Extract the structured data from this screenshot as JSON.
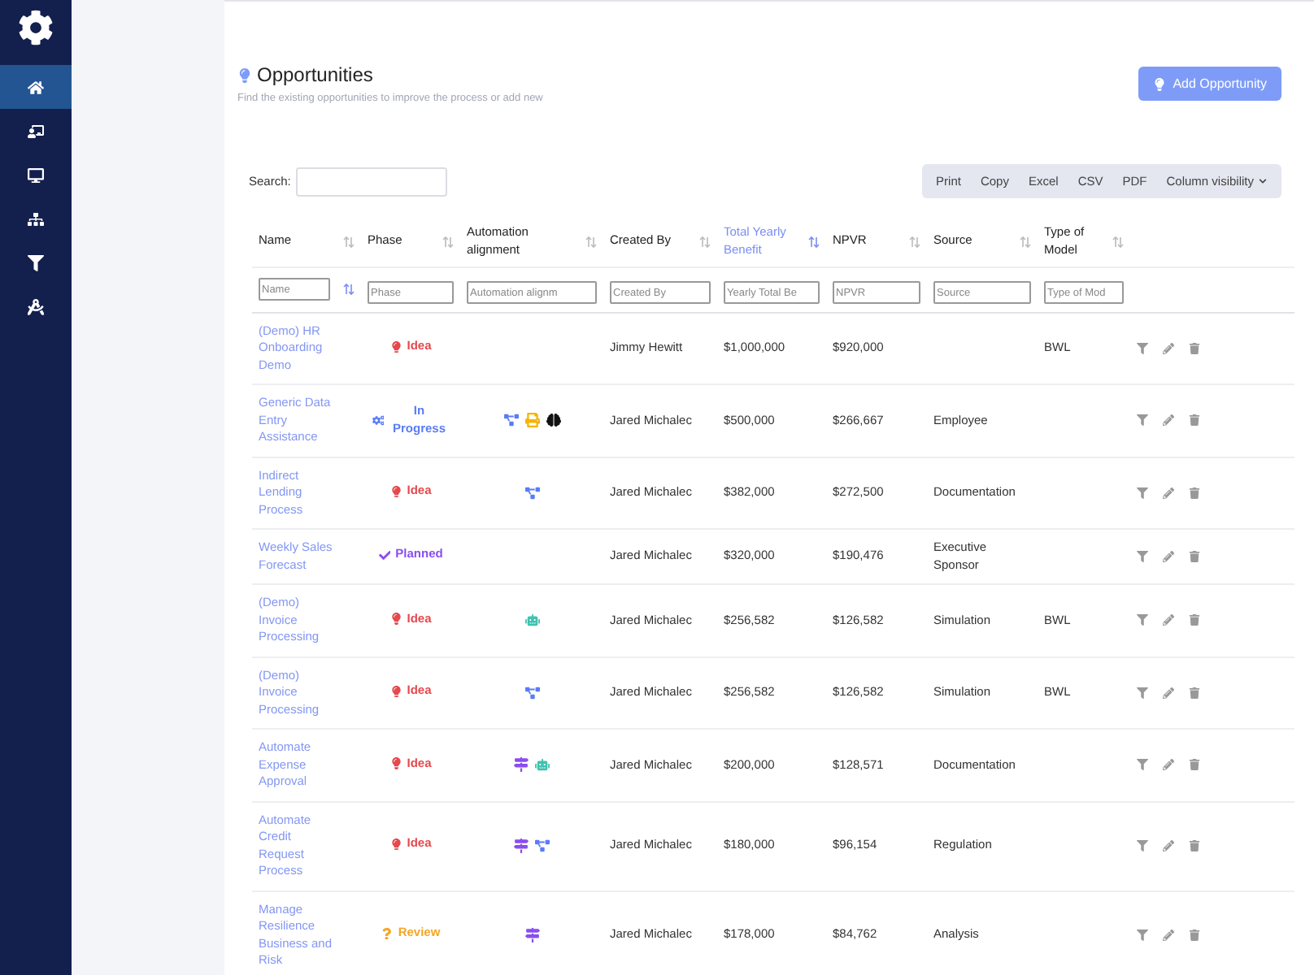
{
  "sidebar": {
    "items": [
      {
        "kind": "home",
        "selected": true
      },
      {
        "kind": "presenter",
        "selected": false
      },
      {
        "kind": "desktop",
        "selected": false
      },
      {
        "kind": "sitemap",
        "selected": false
      },
      {
        "kind": "filter",
        "selected": false
      },
      {
        "kind": "compass",
        "selected": false
      }
    ]
  },
  "header": {
    "title": "Opportunities",
    "subtitle": "Find the existing opportunities to improve the process or add new",
    "add_button": "Add Opportunity"
  },
  "search": {
    "label": "Search:"
  },
  "export_buttons": [
    "Print",
    "Copy",
    "Excel",
    "CSV",
    "PDF"
  ],
  "column_visibility": "Column visibility",
  "table": {
    "columns": [
      {
        "label": "Name",
        "filter_placeholder": "Name",
        "selected": false
      },
      {
        "label": "Phase",
        "filter_placeholder": "Phase",
        "selected": false
      },
      {
        "label": "Automation alignment",
        "filter_placeholder": "Automation alignm",
        "selected": false
      },
      {
        "label": "Created By",
        "filter_placeholder": "Created By",
        "selected": false
      },
      {
        "label": "Total Yearly Benefit",
        "filter_placeholder": "Yearly Total Be",
        "selected": true
      },
      {
        "label": "NPVR",
        "filter_placeholder": "NPVR",
        "selected": false
      },
      {
        "label": "Source",
        "filter_placeholder": "Source",
        "selected": false
      },
      {
        "label": "Type of Model",
        "filter_placeholder": "Type of Mod",
        "selected": false
      }
    ],
    "rows": [
      {
        "name": "(Demo) HR Onboarding Demo",
        "phase": {
          "kind": "idea",
          "label": "Idea"
        },
        "automation": [],
        "created_by": "Jimmy Hewitt",
        "benefit": "$1,000,000",
        "npvr": "$920,000",
        "source": "",
        "model": "BWL"
      },
      {
        "name": "Generic Data Entry Assistance",
        "phase": {
          "kind": "in_progress",
          "label": "In Progress"
        },
        "automation": [
          {
            "kind": "nodes"
          },
          {
            "kind": "printer"
          },
          {
            "kind": "brain"
          }
        ],
        "created_by": "Jared Michalec",
        "benefit": "$500,000",
        "npvr": "$266,667",
        "source": "Employee",
        "model": ""
      },
      {
        "name": "Indirect Lending Process",
        "phase": {
          "kind": "idea",
          "label": "Idea"
        },
        "automation": [
          {
            "kind": "nodes"
          }
        ],
        "created_by": "Jared Michalec",
        "benefit": "$382,000",
        "npvr": "$272,500",
        "source": "Documentation",
        "model": ""
      },
      {
        "name": "Weekly Sales Forecast",
        "phase": {
          "kind": "planned",
          "label": "Planned"
        },
        "automation": [],
        "created_by": "Jared Michalec",
        "benefit": "$320,000",
        "npvr": "$190,476",
        "source": "Executive Sponsor",
        "model": ""
      },
      {
        "name": "(Demo) Invoice Processing",
        "phase": {
          "kind": "idea",
          "label": "Idea"
        },
        "automation": [
          {
            "kind": "robot"
          }
        ],
        "created_by": "Jared Michalec",
        "benefit": "$256,582",
        "npvr": "$126,582",
        "source": "Simulation",
        "model": "BWL"
      },
      {
        "name": "(Demo) Invoice Processing",
        "phase": {
          "kind": "idea",
          "label": "Idea"
        },
        "automation": [
          {
            "kind": "nodes"
          }
        ],
        "created_by": "Jared Michalec",
        "benefit": "$256,582",
        "npvr": "$126,582",
        "source": "Simulation",
        "model": "BWL"
      },
      {
        "name": "Automate Expense Approval",
        "phase": {
          "kind": "idea",
          "label": "Idea"
        },
        "automation": [
          {
            "kind": "signpost"
          },
          {
            "kind": "robot"
          }
        ],
        "created_by": "Jared Michalec",
        "benefit": "$200,000",
        "npvr": "$128,571",
        "source": "Documentation",
        "model": ""
      },
      {
        "name": "Automate Credit Request Process",
        "phase": {
          "kind": "idea",
          "label": "Idea"
        },
        "automation": [
          {
            "kind": "signpost"
          },
          {
            "kind": "nodes"
          }
        ],
        "created_by": "Jared Michalec",
        "benefit": "$180,000",
        "npvr": "$96,154",
        "source": "Regulation",
        "model": ""
      },
      {
        "name": "Manage Resilience Business and Risk",
        "phase": {
          "kind": "review",
          "label": "Review"
        },
        "automation": [
          {
            "kind": "signpost"
          }
        ],
        "created_by": "Jared Michalec",
        "benefit": "$178,000",
        "npvr": "$84,762",
        "source": "Analysis",
        "model": ""
      }
    ]
  }
}
